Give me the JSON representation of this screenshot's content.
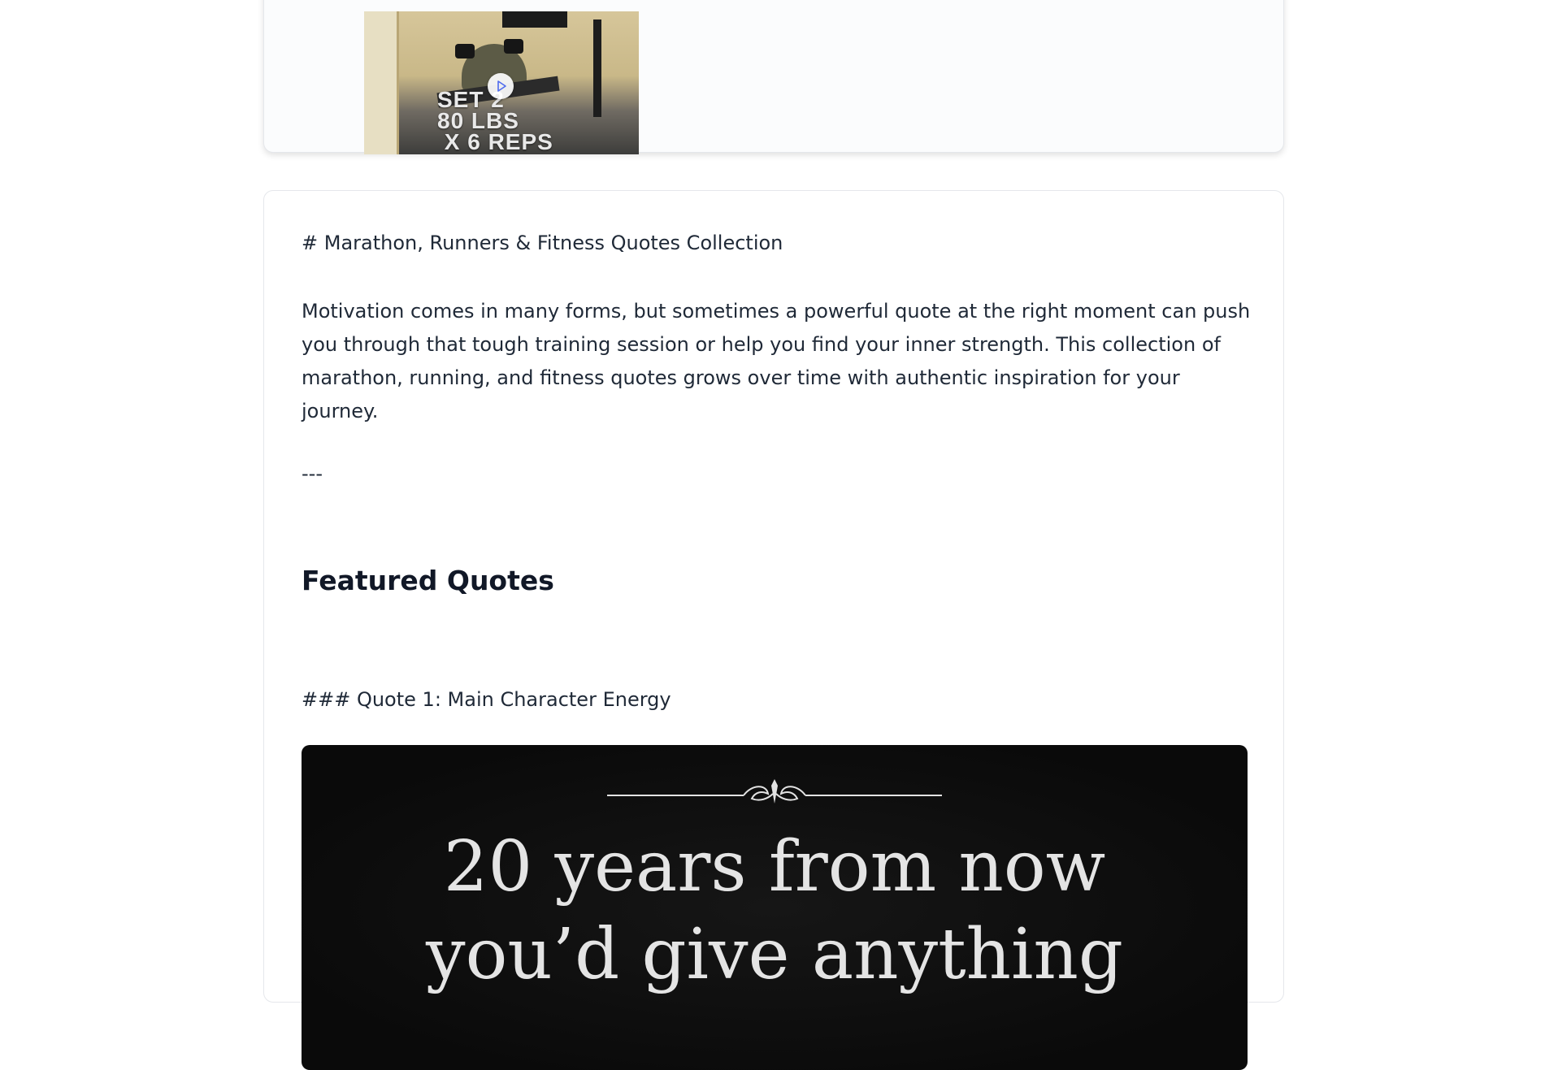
{
  "video_card": {
    "thumbnail_text": "SET 2\n80 LBS\n X 6 REPS",
    "play_icon": "play-icon"
  },
  "article": {
    "title_line": "# Marathon, Runners & Fitness Quotes Collection",
    "intro_lines": [
      "Motivation comes in many forms, but sometimes a powerful quote at the right moment can push",
      "you through that tough training session or help you find your inner strength. This collection of",
      "marathon, running, and fitness quotes grows over time with authentic inspiration for your",
      "journey."
    ],
    "divider": "---",
    "featured_heading": "Featured Quotes",
    "quote1_heading": "### Quote 1: Main Character Energy",
    "quote1_image_lines": [
      "20 years from now",
      "you’d give anything"
    ]
  },
  "colors": {
    "text": "#1f2937",
    "heading": "#111827",
    "quote_bg": "#0a0a0a",
    "quote_text": "#e4e4e4",
    "play_accent": "#4f6bed"
  }
}
